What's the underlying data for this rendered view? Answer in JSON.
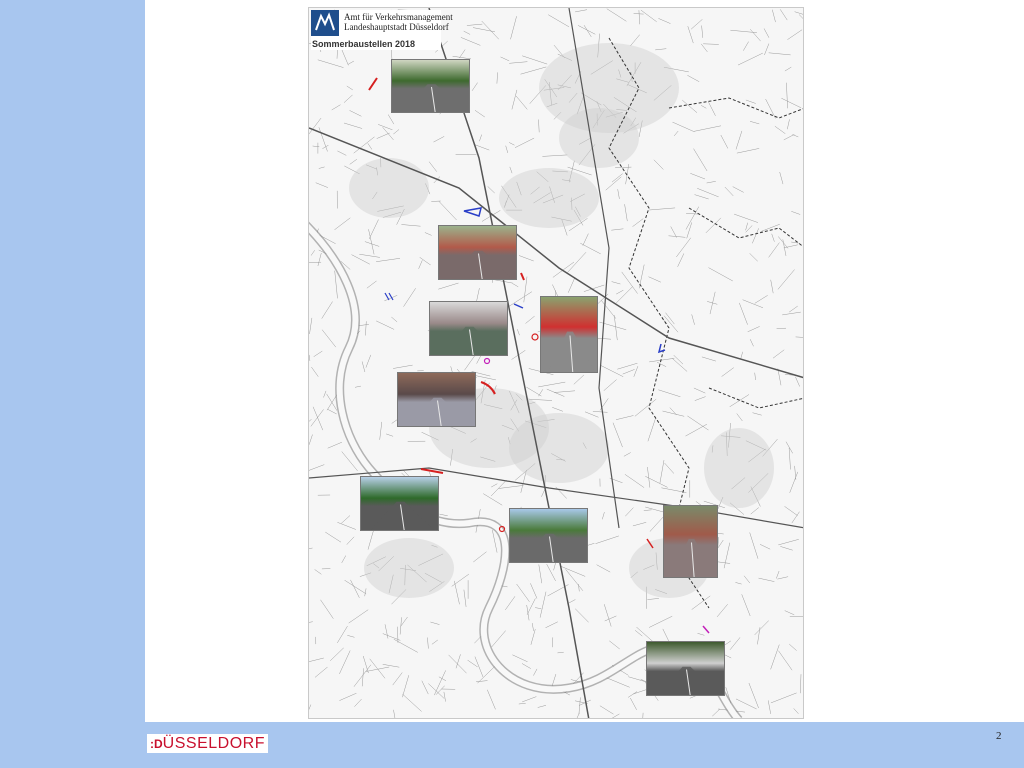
{
  "slide": {
    "page_number": "2",
    "logo": {
      "mark": ":D",
      "text": "ÜSSELDORF"
    },
    "colors": {
      "band": "#a8c6ef",
      "logo_red": "#c8102e",
      "emblem_blue": "#1f4e8c"
    }
  },
  "map": {
    "header": {
      "line1": "Amt für Verkehrsmanagement",
      "line2": "Landeshauptstadt Düsseldorf",
      "title": "Sommerbaustellen 2018"
    },
    "photos": [
      {
        "name": "photo-road-north",
        "scene": "road"
      },
      {
        "name": "photo-bike-lane",
        "scene": "bikelane"
      },
      {
        "name": "photo-bridge",
        "scene": "bridge"
      },
      {
        "name": "photo-crossing",
        "scene": "crossing"
      },
      {
        "name": "photo-paving",
        "scene": "paving"
      },
      {
        "name": "photo-street-trees",
        "scene": "trees"
      },
      {
        "name": "photo-sidewalk",
        "scene": "sidewalk"
      },
      {
        "name": "photo-brick-path",
        "scene": "brick"
      },
      {
        "name": "photo-road-south",
        "scene": "roadsouth"
      }
    ]
  }
}
